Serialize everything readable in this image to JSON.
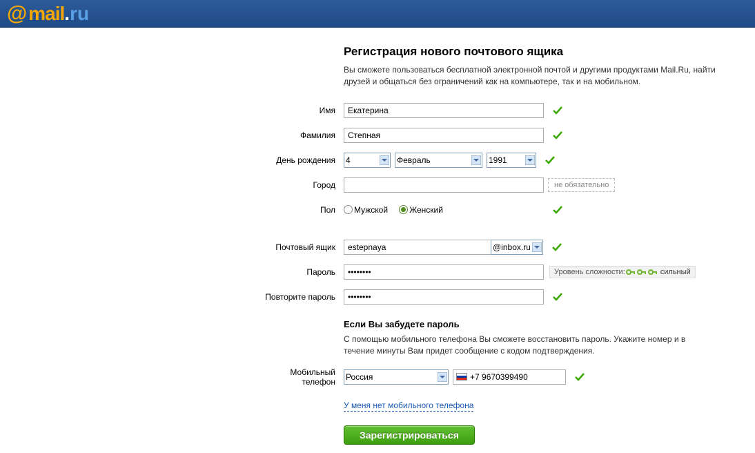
{
  "header": {
    "logo_at": "@",
    "logo_mail": "mail",
    "logo_dot": ".",
    "logo_ru": "ru"
  },
  "page": {
    "title": "Регистрация нового почтового ящика",
    "intro": "Вы сможете пользоваться бесплатной электронной почтой и другими продуктами Mail.Ru, найти друзей и общаться без ограничений как на компьютере, так и на мобильном."
  },
  "labels": {
    "first_name": "Имя",
    "last_name": "Фамилия",
    "birthday": "День рождения",
    "city": "Город",
    "gender": "Пол",
    "mailbox": "Почтовый ящик",
    "password": "Пароль",
    "password_repeat": "Повторите пароль",
    "mobile_phone": "Мобильный телефон"
  },
  "values": {
    "first_name": "Екатерина",
    "last_name": "Степная",
    "birth_day": "4",
    "birth_month": "Февраль",
    "birth_year": "1991",
    "city": "",
    "mailbox": "estepnaya",
    "domain": "@inbox.ru",
    "password": "••••••••",
    "password_repeat": "••••••••",
    "country": "Россия",
    "phone": "+7 9670399490"
  },
  "hints": {
    "optional": "не обязательно"
  },
  "gender": {
    "male": "Мужской",
    "female": "Женский",
    "selected": "female"
  },
  "password_strength": {
    "prefix": "Уровень сложности:",
    "label": "сильный"
  },
  "recovery": {
    "title": "Если Вы забудете пароль",
    "text": "С помощью мобильного телефона Вы сможете восстановить пароль. Укажите номер и в течение минуты Вам придет сообщение с кодом подтверждения."
  },
  "links": {
    "no_phone": "У меня нет мобильного телефона"
  },
  "buttons": {
    "submit": "Зарегистрироваться"
  }
}
